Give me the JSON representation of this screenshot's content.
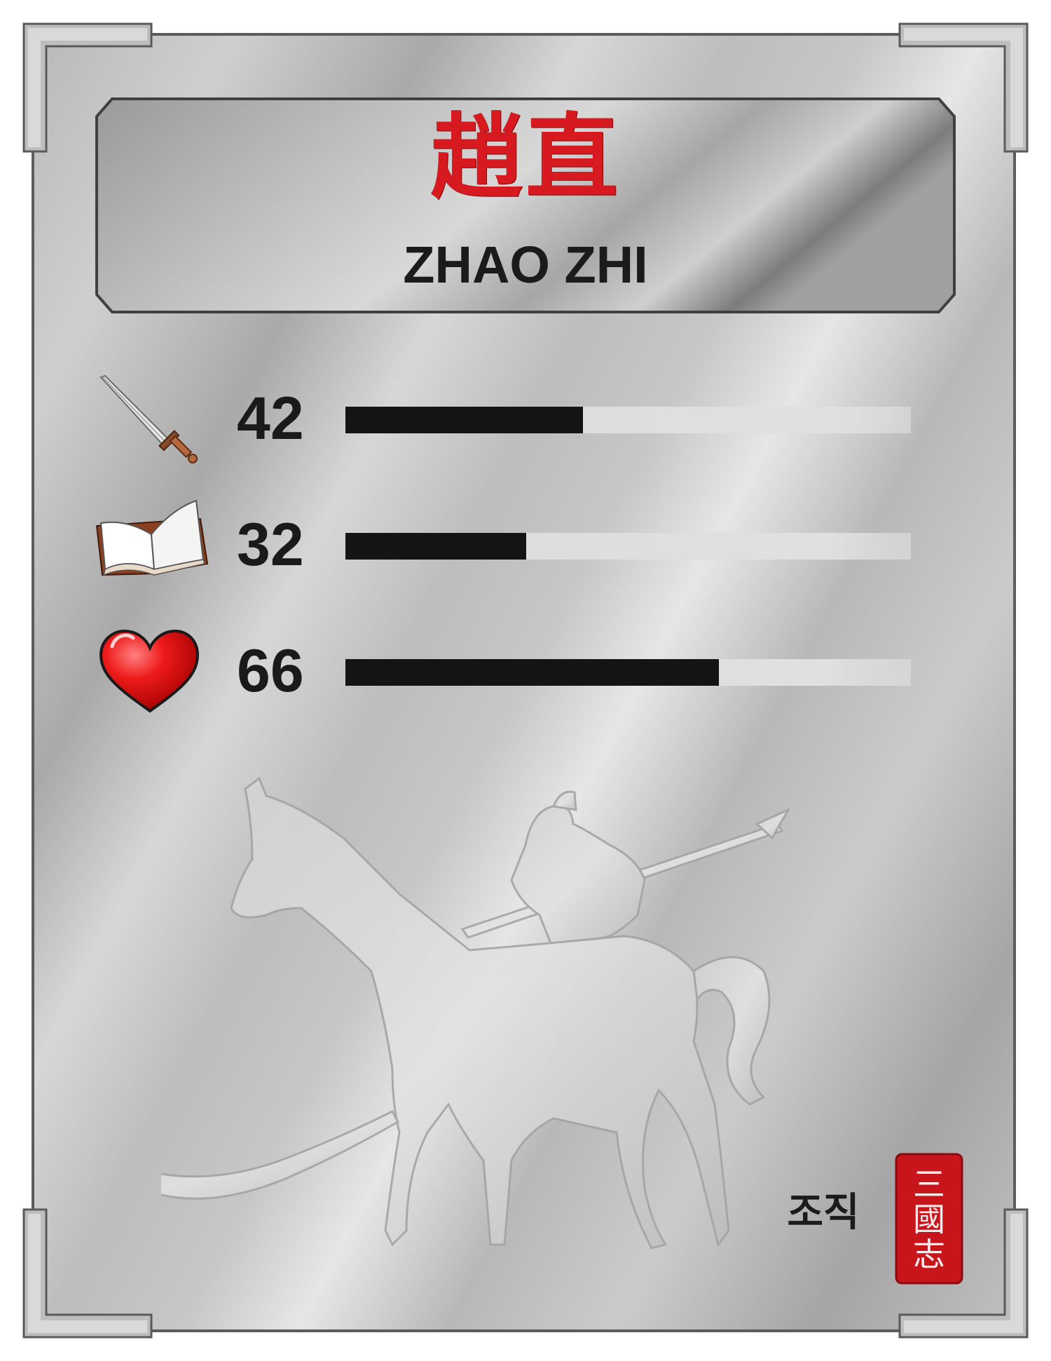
{
  "card": {
    "name_chinese": "趙直",
    "name_english": "ZHAO ZHI",
    "name_korean": "조직",
    "seal_text": "三國志"
  },
  "stats": [
    {
      "icon": "sword-icon",
      "value": "42",
      "fraction": 0.42
    },
    {
      "icon": "book-icon",
      "value": "32",
      "fraction": 0.32
    },
    {
      "icon": "heart-icon",
      "value": "66",
      "fraction": 0.66
    }
  ],
  "colors": {
    "title_red": "#d71920",
    "bar_fill": "#141414",
    "bar_track": "#dcdcdc",
    "seal_red": "#c8141b"
  }
}
